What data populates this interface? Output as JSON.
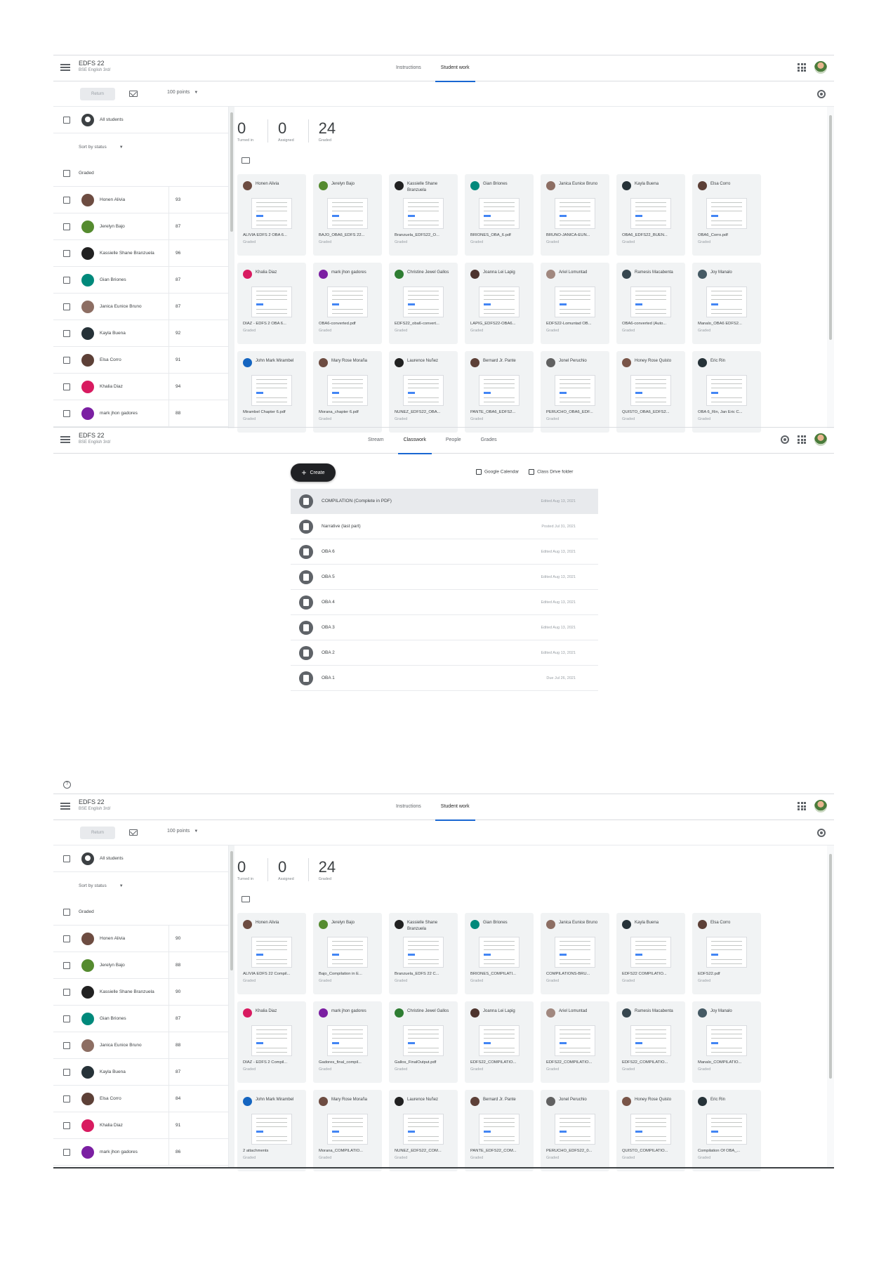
{
  "class": {
    "title": "EDFS 22",
    "subtitle": "BSE English 3rd/"
  },
  "top_tabs": [
    "Instructions",
    "Student work"
  ],
  "classwork_tabs": [
    "Stream",
    "Classwork",
    "People",
    "Grades"
  ],
  "actions": {
    "return_label": "Return",
    "points_label": "100 points"
  },
  "list_labels": {
    "all_students": "All students",
    "sort": "Sort by status",
    "graded": "Graded"
  },
  "stats": [
    {
      "num": "0",
      "label": "Turned in"
    },
    {
      "num": "0",
      "label": "Assigned"
    },
    {
      "num": "24",
      "label": "Graded"
    }
  ],
  "students": [
    {
      "name": "Honen Alivia",
      "grade1": "93",
      "grade2": "90",
      "color": "#6d4c41"
    },
    {
      "name": "Jerelyn Bajo",
      "grade1": "87",
      "grade2": "88",
      "color": "#558b2f"
    },
    {
      "name": "Kassielle Shane Branzuela",
      "grade1": "96",
      "grade2": "90",
      "color": "#212121"
    },
    {
      "name": "Gian Briones",
      "grade1": "87",
      "grade2": "87",
      "color": "#00897b"
    },
    {
      "name": "Janica Eunice Bruno",
      "grade1": "87",
      "grade2": "88",
      "color": "#8d6e63"
    },
    {
      "name": "Kayla Buena",
      "grade1": "92",
      "grade2": "87",
      "color": "#263238"
    },
    {
      "name": "Elsa Corro",
      "grade1": "91",
      "grade2": "84",
      "color": "#5d4037"
    },
    {
      "name": "Khalia Diaz",
      "grade1": "94",
      "grade2": "91",
      "color": "#d81b60"
    },
    {
      "name": "mark jhon gadores",
      "grade1": "88",
      "grade2": "86",
      "color": "#7b1fa2"
    }
  ],
  "cards_top": [
    {
      "name": "Honen Alivia",
      "file": "ALIVIA EDFS 2 OBA 6...",
      "status": "Graded",
      "color": "#6d4c41"
    },
    {
      "name": "Jerelyn Bajo",
      "file": "BAJO_OBA6_EDFS 22...",
      "status": "Graded",
      "color": "#558b2f"
    },
    {
      "name": "Kassielle Shane Branzuela",
      "file": "Branzuela_EDFS22_O...",
      "status": "Graded",
      "color": "#212121"
    },
    {
      "name": "Gian Briones",
      "file": "BRIONES_OBA_6.pdf",
      "status": "Graded",
      "color": "#00897b"
    },
    {
      "name": "Janica Eunice Bruno",
      "file": "BRUNO-JANICA-EUN...",
      "status": "Graded",
      "color": "#8d6e63"
    },
    {
      "name": "Kayla Buena",
      "file": "OBA6_EDFS22_BUEN...",
      "status": "Graded",
      "color": "#263238"
    },
    {
      "name": "Elsa Corro",
      "file": "OBA6_Corro.pdf",
      "status": "Graded",
      "color": "#5d4037"
    },
    {
      "name": "Khalia Diaz",
      "file": "DIAZ - EDFS 2 OBA 6...",
      "status": "Graded",
      "color": "#d81b60"
    },
    {
      "name": "mark jhon gadores",
      "file": "OBA6-converted.pdf",
      "status": "Graded",
      "color": "#7b1fa2"
    },
    {
      "name": "Christine Jewel Gallos",
      "file": "EDFS22_oba6-convert...",
      "status": "Graded",
      "color": "#2e7d32"
    },
    {
      "name": "Joanna Lei Lapig",
      "file": "LAPIG_EDFS22-OBA6...",
      "status": "Graded",
      "color": "#4e342e"
    },
    {
      "name": "Ariel Lomuntad",
      "file": "EDFS22-Lomuntad OB...",
      "status": "Graded",
      "color": "#a1887f"
    },
    {
      "name": "Ramesis Macabenta",
      "file": "OBA6-converted (Auto...",
      "status": "Graded",
      "color": "#37474f"
    },
    {
      "name": "Joy Manalo",
      "file": "Manalo_OBA6 EDFS2...",
      "status": "Graded",
      "color": "#455a64"
    },
    {
      "name": "John Mark Mirambel",
      "file": "Mirambel Chapter 6.pdf",
      "status": "Graded",
      "color": "#1565c0"
    },
    {
      "name": "Mary Rose Moraña",
      "file": "Morana_chapter 6.pdf",
      "status": "Graded",
      "color": "#6d4c41"
    },
    {
      "name": "Laurence Nuñez",
      "file": "NUNEZ_EDFS22_OBA...",
      "status": "Graded",
      "color": "#212121"
    },
    {
      "name": "Bernard Jr. Pante",
      "file": "PANTE_OBA6_EDFS2...",
      "status": "Graded",
      "color": "#5d4037"
    },
    {
      "name": "Jonel Peruchio",
      "file": "PERUCHO_OBA6_EDF...",
      "status": "Graded",
      "color": "#616161"
    },
    {
      "name": "Honey Rose Quisto",
      "file": "QUISTO_OBA6_EDFS2...",
      "status": "Graded",
      "color": "#795548"
    },
    {
      "name": "Eric Rin",
      "file": "OBA 6_Rin, Jan Eric C...",
      "status": "Graded",
      "color": "#263238"
    }
  ],
  "cards_bottom": [
    {
      "file": "ALIVIA EDFS 22 Compil...",
      "status": "Graded"
    },
    {
      "file": "Bajo_Compilation in E...",
      "status": "Graded"
    },
    {
      "file": "Branzuela_EDFS 22 C...",
      "status": "Graded"
    },
    {
      "file": "BRIONES_COMPILATI...",
      "status": "Graded"
    },
    {
      "file": "COMPILATIONS-BRU...",
      "status": "Graded"
    },
    {
      "file": "EDFS22 COMPILATIO...",
      "status": "Graded"
    },
    {
      "file": "EDFS22.pdf",
      "status": "Graded"
    },
    {
      "file": "DIAZ - EDFS 2 Compil...",
      "status": "Graded"
    },
    {
      "file": "Gadores_final_compil...",
      "status": "Graded"
    },
    {
      "file": "Gallos_FinalOutput.pdf",
      "status": "Graded"
    },
    {
      "file": "EDFS22_COMPILATIO...",
      "status": "Graded"
    },
    {
      "file": "EDFS22_COMPILATIO...",
      "status": "Graded"
    },
    {
      "file": "EDFS22_COMPILATIO...",
      "status": "Graded"
    },
    {
      "file": "Manalo_COMPILATIO...",
      "status": "Graded"
    },
    {
      "file": "2 attachments",
      "status": "Graded"
    },
    {
      "file": "Morana_COMPILATIO...",
      "status": "Graded"
    },
    {
      "file": "NUNEZ_EDFS22_COM...",
      "status": "Graded"
    },
    {
      "file": "PANTE_EDFS22_COM...",
      "status": "Graded"
    },
    {
      "file": "PERUCHO_EDFS22_0...",
      "status": "Graded"
    },
    {
      "file": "QUISTO_COMPILATIO...",
      "status": "Graded"
    },
    {
      "file": "Compilation Of OBA_...",
      "status": "Graded"
    }
  ],
  "classwork": {
    "create_label": "Create",
    "calendar_label": "Google Calendar",
    "drive_label": "Class Drive folder",
    "items": [
      {
        "title": "COMPILATION (Complete in PDF)",
        "date": "Edited Aug 13, 2021"
      },
      {
        "title": "Narrative (last part)",
        "date": "Posted Jul 31, 2021"
      },
      {
        "title": "OBA 6",
        "date": "Edited Aug 13, 2021"
      },
      {
        "title": "OBA 5",
        "date": "Edited Aug 13, 2021"
      },
      {
        "title": "OBA 4",
        "date": "Edited Aug 13, 2021"
      },
      {
        "title": "OBA 3",
        "date": "Edited Aug 13, 2021"
      },
      {
        "title": "OBA 2",
        "date": "Edited Aug 13, 2021"
      },
      {
        "title": "OBA 1",
        "date": "Due Jul 26, 2021"
      }
    ]
  }
}
